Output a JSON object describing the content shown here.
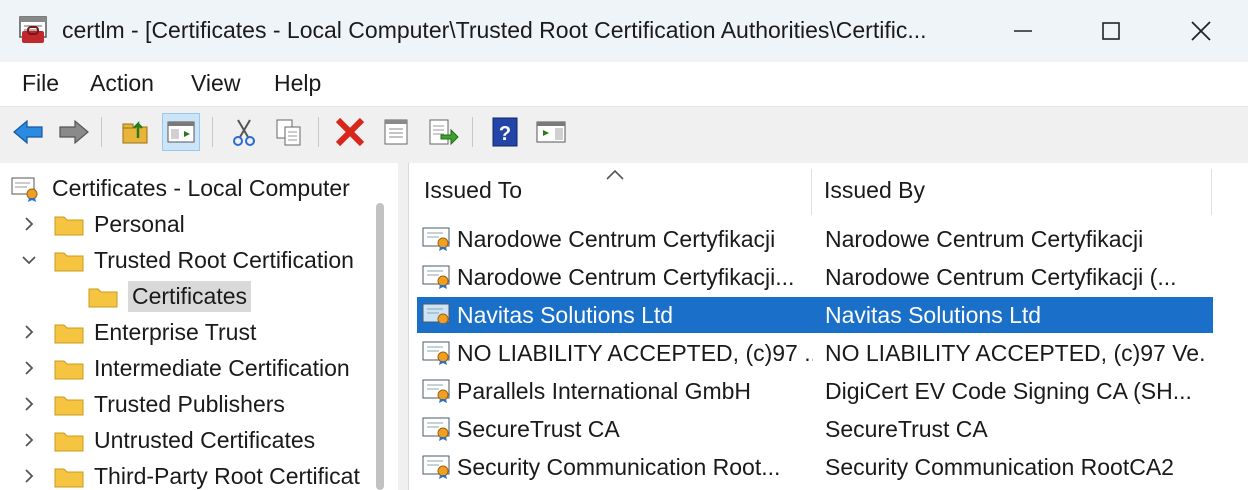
{
  "window": {
    "title": "certlm - [Certificates - Local Computer\\Trusted Root Certification Authorities\\Certific...",
    "minimize_glyph": "—",
    "maximize_glyph": "☐",
    "close_glyph": "✕"
  },
  "menu": {
    "file": "File",
    "action": "Action",
    "view": "View",
    "help": "Help"
  },
  "toolbar": {
    "icons": [
      "back-arrow-icon",
      "forward-arrow-icon",
      "up-folder-icon",
      "show-hide-tree-icon",
      "cut-icon",
      "copy-icon",
      "delete-icon",
      "properties-icon",
      "export-list-icon",
      "help-icon",
      "action-pane-icon"
    ]
  },
  "tree": {
    "root": "Certificates - Local Computer",
    "items": [
      {
        "label": "Personal"
      },
      {
        "label": "Trusted Root Certification"
      },
      {
        "label": "Certificates"
      },
      {
        "label": "Enterprise Trust"
      },
      {
        "label": "Intermediate Certification"
      },
      {
        "label": "Trusted Publishers"
      },
      {
        "label": "Untrusted Certificates"
      },
      {
        "label": "Third-Party Root Certificat"
      }
    ]
  },
  "list": {
    "columns": {
      "issued_to": "Issued To",
      "issued_by": "Issued By"
    },
    "sort_glyph": "^",
    "rows": [
      {
        "to": "Narodowe Centrum Certyfikacji",
        "by": "Narodowe Centrum Certyfikacji"
      },
      {
        "to": "Narodowe Centrum Certyfikacji...",
        "by": "Narodowe Centrum Certyfikacji (..."
      },
      {
        "to": "Navitas Solutions Ltd",
        "by": "Navitas Solutions Ltd"
      },
      {
        "to": "NO LIABILITY ACCEPTED, (c)97 ...",
        "by": "NO LIABILITY ACCEPTED, (c)97 Ve..."
      },
      {
        "to": "Parallels International GmbH",
        "by": "DigiCert EV Code Signing CA (SH..."
      },
      {
        "to": "SecureTrust CA",
        "by": "SecureTrust CA"
      },
      {
        "to": "Security Communication Root...",
        "by": "Security Communication RootCA2"
      }
    ]
  },
  "colors": {
    "selection": "#1a70c8",
    "titlebar": "#eff4f9",
    "folder": "#f5c542"
  }
}
